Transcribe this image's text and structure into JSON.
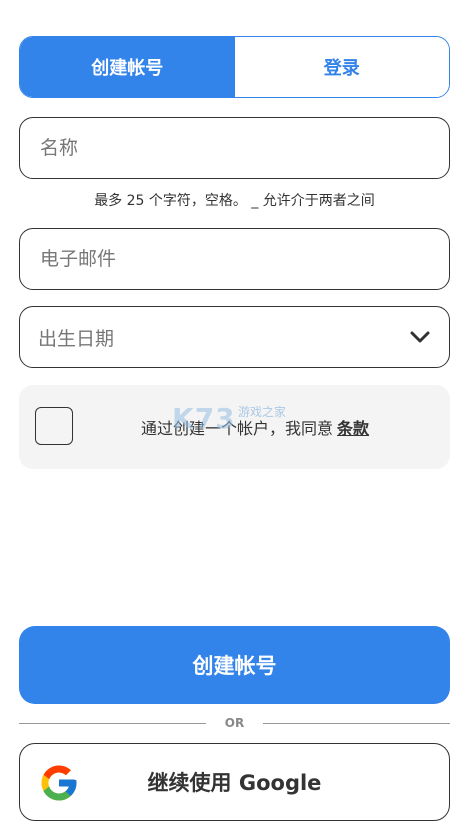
{
  "tabs": {
    "create": "创建帐号",
    "login": "登录"
  },
  "name_field": {
    "placeholder": "名称",
    "hint": "最多 25 个字符，空格。 _ 允许介于两者之间"
  },
  "email_field": {
    "placeholder": "电子邮件"
  },
  "birthday_field": {
    "placeholder": "出生日期"
  },
  "terms": {
    "text": "通过创建一个帐户，我同意",
    "link": "条款"
  },
  "watermark": {
    "logo": "K73",
    "sub": "游戏之家"
  },
  "primary_button": {
    "label": "创建帐号"
  },
  "divider": {
    "label": "OR"
  },
  "google_button": {
    "label": "继续使用 Google"
  },
  "colors": {
    "accent": "#3283ea",
    "border": "#333333",
    "terms_bg": "#f4f4f4"
  }
}
